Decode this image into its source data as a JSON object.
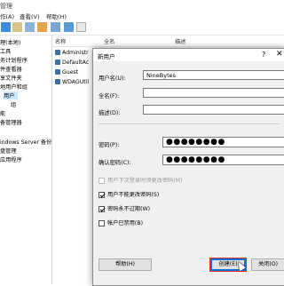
{
  "window": {
    "title": "管理"
  },
  "menu": {
    "items": [
      "作(A)",
      "查看(V)",
      "帮助(H)"
    ]
  },
  "tree": {
    "nodes": [
      "理(本地)",
      "工具",
      "务计划程序",
      "件查看器",
      "享文件夹",
      "地用户和组",
      "用户",
      "组",
      "能",
      "备管理器",
      "",
      "indows Server 备份",
      "盘管理",
      "应用程序"
    ]
  },
  "list": {
    "columns": [
      "名称",
      "全名",
      "描述"
    ],
    "rows": [
      "Administr",
      "DefaultAc",
      "Guest",
      "WDAGUtil"
    ]
  },
  "dialog": {
    "title": "新用户",
    "help_glyph": "?",
    "close_glyph": "✕",
    "username_label": "用户名(U):",
    "username_value": "NineBytes",
    "fullname_label": "全名(F):",
    "fullname_value": "",
    "desc_label": "描述(D):",
    "desc_value": "",
    "password_label": "密码(P):",
    "password_value": "●●●●●●●●",
    "confirm_label": "确认密码(C):",
    "confirm_value": "●●●●●●●●",
    "cb1": "用户下次登录时须更改密码(M)",
    "cb2": "用户不能更改密码(S)",
    "cb3": "密码永不过期(W)",
    "cb4": "帐户已禁用(B)",
    "help_button": "帮助(H)",
    "create_button": "创建(E)",
    "close_button": "关闭(O)"
  },
  "colors": {
    "accent": "#0078d7",
    "highlight": "#ee2222"
  }
}
